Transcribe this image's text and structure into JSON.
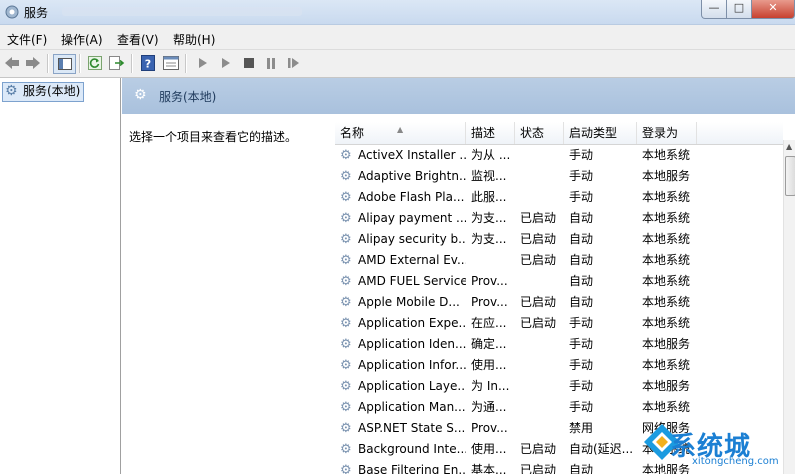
{
  "window": {
    "title": "服务",
    "min_label": "—",
    "max_label": "□",
    "close_label": "✕"
  },
  "menu": [
    "文件(F)",
    "操作(A)",
    "查看(V)",
    "帮助(H)"
  ],
  "toolbar_icons": [
    "back-arrow-icon",
    "forward-arrow-icon",
    "show-hide-console-tree-icon",
    "refresh-icon",
    "export-list-icon",
    "help-icon",
    "properties-icon",
    "start-service-icon",
    "start-service-params-icon",
    "stop-service-icon",
    "pause-service-icon",
    "restart-service-icon"
  ],
  "tree": {
    "label": "服务(本地)"
  },
  "panel": {
    "title": "服务(本地)",
    "description": "选择一个项目来查看它的描述。"
  },
  "columns": {
    "name": "名称",
    "desc": "描述",
    "status": "状态",
    "start": "启动类型",
    "logon": "登录为"
  },
  "rows": [
    {
      "name": "ActiveX Installer ...",
      "desc": "为从 ...",
      "status": "",
      "start": "手动",
      "logon": "本地系统"
    },
    {
      "name": "Adaptive Brightn...",
      "desc": "监视...",
      "status": "",
      "start": "手动",
      "logon": "本地服务"
    },
    {
      "name": "Adobe Flash Pla...",
      "desc": "此服...",
      "status": "",
      "start": "手动",
      "logon": "本地系统"
    },
    {
      "name": "Alipay payment ...",
      "desc": "为支...",
      "status": "已启动",
      "start": "自动",
      "logon": "本地系统"
    },
    {
      "name": "Alipay security b...",
      "desc": "为支...",
      "status": "已启动",
      "start": "自动",
      "logon": "本地系统"
    },
    {
      "name": "AMD External Ev...",
      "desc": "",
      "status": "已启动",
      "start": "自动",
      "logon": "本地系统"
    },
    {
      "name": "AMD FUEL Service",
      "desc": "Prov...",
      "status": "",
      "start": "自动",
      "logon": "本地系统"
    },
    {
      "name": "Apple Mobile D...",
      "desc": "Prov...",
      "status": "已启动",
      "start": "自动",
      "logon": "本地系统"
    },
    {
      "name": "Application Expe...",
      "desc": "在应...",
      "status": "已启动",
      "start": "手动",
      "logon": "本地系统"
    },
    {
      "name": "Application Iden...",
      "desc": "确定...",
      "status": "",
      "start": "手动",
      "logon": "本地服务"
    },
    {
      "name": "Application Infor...",
      "desc": "使用...",
      "status": "",
      "start": "手动",
      "logon": "本地系统"
    },
    {
      "name": "Application Laye...",
      "desc": "为 In...",
      "status": "",
      "start": "手动",
      "logon": "本地服务"
    },
    {
      "name": "Application Man...",
      "desc": "为通...",
      "status": "",
      "start": "手动",
      "logon": "本地系统"
    },
    {
      "name": "ASP.NET State S...",
      "desc": "Prov...",
      "status": "",
      "start": "禁用",
      "logon": "网络服务"
    },
    {
      "name": "Background Inte...",
      "desc": "使用...",
      "status": "已启动",
      "start": "自动(延迟...",
      "logon": "本地系统"
    },
    {
      "name": "Base Filtering En...",
      "desc": "基本...",
      "status": "已启动",
      "start": "自动",
      "logon": "本地服务"
    }
  ],
  "watermark": {
    "text": "系统城",
    "url": "xitongcheng.com"
  }
}
